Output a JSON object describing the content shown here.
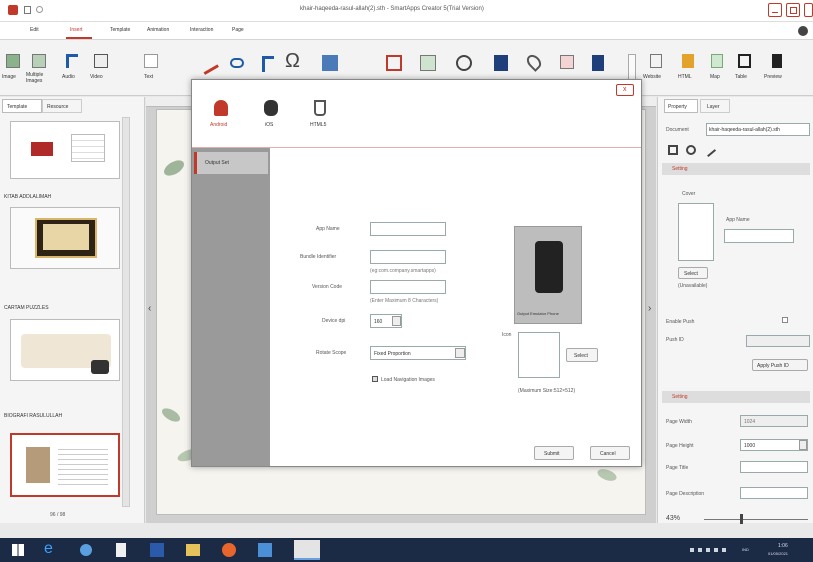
{
  "window": {
    "title": "khair-haqeeda-rasul-allah(2).sth - SmartApps Creator 5(Trial Version)"
  },
  "menu": {
    "items": [
      "Edit",
      "Insert",
      "Template",
      "Animation",
      "Interaction",
      "Page"
    ]
  },
  "toolbar": {
    "left": [
      "Image",
      "Multiple Images",
      "Audio",
      "Video",
      "Text"
    ],
    "right": [
      "Website",
      "HTML",
      "Map",
      "Table",
      "Preview"
    ]
  },
  "left_panel": {
    "tabs": [
      "Template",
      "Resource"
    ],
    "sections": [
      "KITAB ADDLALIMAH",
      "CARTAM PUZZLES",
      "BIOGRAFI RASULULLAH"
    ],
    "page_counter": "96 / 98"
  },
  "right_panel": {
    "tabs": [
      "Property",
      "Layer"
    ],
    "document_label": "Document",
    "document_value": "khair-haqeeda-rasul-allah(2).sth",
    "settings_header": "Setting",
    "cover_label": "Cover",
    "app_name_label": "App Name",
    "select_button": "Select",
    "unavailable": "(Unavailable)",
    "enable_push": "Enable Push",
    "push_id": "Push ID",
    "apply_push": "Apply Push ID",
    "settings_header2": "Setting",
    "page_width": "Page Width",
    "page_width_val": "1024",
    "page_height": "Page Height",
    "page_height_val": "1000",
    "page_title": "Page Title",
    "page_description": "Page Description",
    "zoom": "43%"
  },
  "dialog": {
    "platforms": [
      "Android",
      "iOS",
      "HTML5"
    ],
    "side_item": "Output Set",
    "app_name_label": "App Name",
    "bundle_label": "Bundle Identifier",
    "bundle_hint": "(eg:com.company.smartapps)",
    "version_label": "Version Code",
    "version_hint": "(Enter Maximum 8 Characters)",
    "device_label": "Device dpi",
    "device_value": "160",
    "rotate_label": "Rotate Scope",
    "rotate_value": "Fixed Proportion",
    "nav_checkbox": "Load Navigation Images",
    "phone_caption": "Output Emulator Phone",
    "icon_label": "Icon",
    "icon_select": "Select",
    "icon_hint": "(Maximum Size:512×512)",
    "submit": "Submit",
    "cancel": "Cancel",
    "close": "x"
  },
  "taskbar": {
    "time": "1:06",
    "date": "01/05/2021",
    "lang": "IND"
  },
  "colors": {
    "accent": "#c0392b",
    "taskbar": "#1b2a45",
    "thumb_red": "#b12a2a"
  }
}
